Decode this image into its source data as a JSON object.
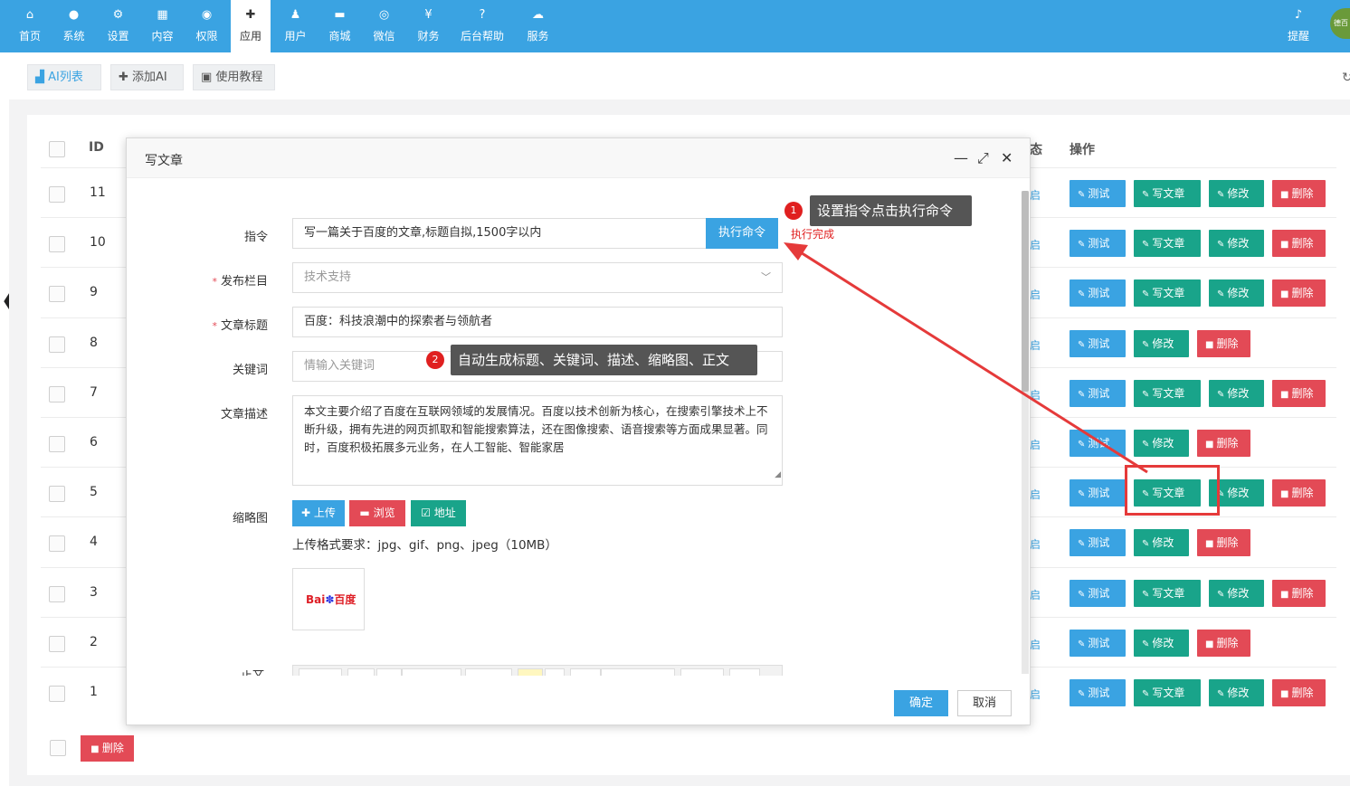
{
  "nav": {
    "items": [
      {
        "label": "首页",
        "icon": "home-icon",
        "glyph": "⌂"
      },
      {
        "label": "系统",
        "icon": "globe-icon",
        "glyph": "●"
      },
      {
        "label": "设置",
        "icon": "gears-icon",
        "glyph": "⚙"
      },
      {
        "label": "内容",
        "icon": "grid-icon",
        "glyph": "▦"
      },
      {
        "label": "权限",
        "icon": "user-circle-icon",
        "glyph": "◉"
      },
      {
        "label": "应用",
        "icon": "puzzle-icon",
        "glyph": "✚"
      },
      {
        "label": "用户",
        "icon": "user-icon",
        "glyph": "♟"
      },
      {
        "label": "商城",
        "icon": "cart-icon",
        "glyph": "▬"
      },
      {
        "label": "微信",
        "icon": "wechat-icon",
        "glyph": "◎"
      },
      {
        "label": "财务",
        "icon": "yen-icon",
        "glyph": "¥"
      },
      {
        "label": "后台帮助",
        "icon": "help-icon",
        "glyph": "?"
      },
      {
        "label": "服务",
        "icon": "cloud-icon",
        "glyph": "☁"
      }
    ],
    "alert": {
      "label": "提醒",
      "glyph": "♪"
    },
    "avatar_text": "德百"
  },
  "tabs": {
    "ai_list": "AI列表",
    "add_ai": "添加AI",
    "tutorial": "使用教程"
  },
  "table": {
    "header_id": "ID",
    "header_status_partial": "态",
    "header_ops": "操作",
    "status_partial": "启",
    "rows": [
      {
        "id": "11",
        "write": true
      },
      {
        "id": "10",
        "write": true
      },
      {
        "id": "9",
        "write": true
      },
      {
        "id": "8",
        "write": false
      },
      {
        "id": "7",
        "write": true
      },
      {
        "id": "6",
        "write": false
      },
      {
        "id": "5",
        "write": true
      },
      {
        "id": "4",
        "write": false
      },
      {
        "id": "3",
        "write": true
      },
      {
        "id": "2",
        "write": false
      },
      {
        "id": "1",
        "write": true
      }
    ],
    "btn_test": "测试",
    "btn_write": "写文章",
    "btn_edit": "修改",
    "btn_delete": "删除",
    "bulk_delete": "删除"
  },
  "modal": {
    "title": "写文章",
    "labels": {
      "instruction": "指令",
      "column": "发布栏目",
      "article_title": "文章标题",
      "keywords": "关键词",
      "description": "文章描述",
      "thumbnail": "缩略图",
      "body": "正文"
    },
    "instruction_value": "写一篇关于百度的文章,标题自拟,1500字以内",
    "exec_button": "执行命令",
    "exec_status": "执行完成",
    "column_value": "技术支持",
    "title_value": "百度：科技浪潮中的探索者与领航者",
    "keywords_placeholder": "情输入关键词",
    "description_value": "本文主要介绍了百度在互联网领域的发展情况。百度以技术创新为核心，在搜索引擎技术上不断升级，拥有先进的网页抓取和智能搜索算法，还在图像搜索、语音搜索等方面成果显著。同时，百度积极拓展多元业务，在人工智能、智能家居",
    "upload_btn": "上传",
    "browse_btn": "浏览",
    "url_btn": "地址",
    "upload_hint": "上传格式要求：jpg、gif、png、jpeg（10MB）",
    "thumb_logo_a": "Bai",
    "thumb_logo_b": "百度",
    "ok": "确定",
    "cancel": "取消"
  },
  "annotations": {
    "step1_num": "1",
    "step1_text": "设置指令点击执行命令",
    "step2_num": "2",
    "step2_text": "自动生成标题、关键词、描述、缩略图、正文"
  },
  "colors": {
    "primary": "#3aa3e2",
    "success": "#19a48a",
    "danger": "#e34a56",
    "annotation_red": "#e53a3a"
  }
}
